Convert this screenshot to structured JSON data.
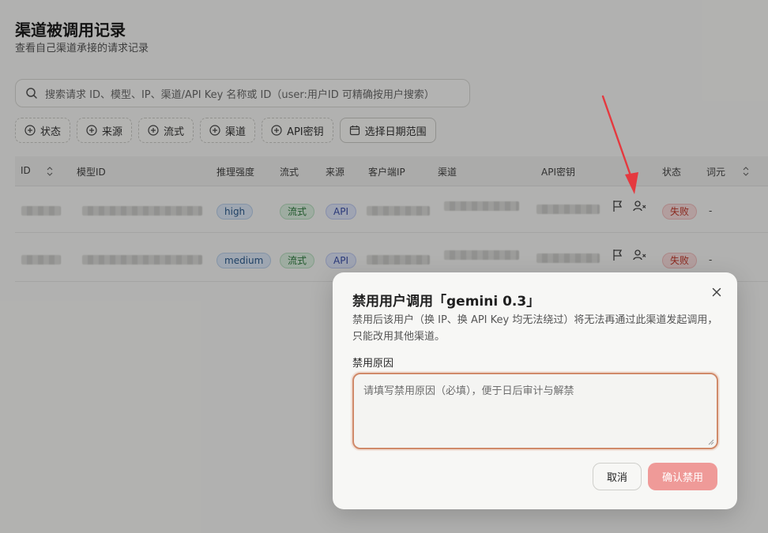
{
  "page": {
    "title": "渠道被调用记录",
    "subtitle": "查看自己渠道承接的请求记录"
  },
  "search": {
    "placeholder": "搜索请求 ID、模型、IP、渠道/API Key 名称或 ID（user:用户ID 可精确按用户搜索）"
  },
  "filters": [
    {
      "label": "状态",
      "icon": "plus-circle-icon"
    },
    {
      "label": "来源",
      "icon": "plus-circle-icon"
    },
    {
      "label": "流式",
      "icon": "plus-circle-icon"
    },
    {
      "label": "渠道",
      "icon": "plus-circle-icon"
    },
    {
      "label": "API密钥",
      "icon": "plus-circle-icon"
    },
    {
      "label": "选择日期范围",
      "icon": "calendar-icon"
    }
  ],
  "table": {
    "columns": [
      "ID",
      "模型ID",
      "推理强度",
      "流式",
      "来源",
      "客户端IP",
      "渠道",
      "API密钥",
      "状态",
      "词元"
    ],
    "rows": [
      {
        "effort": "high",
        "stream": "流式",
        "source": "API",
        "status": "失败",
        "tokens": "-"
      },
      {
        "effort": "medium",
        "stream": "流式",
        "source": "API",
        "status": "失败",
        "tokens": "-"
      }
    ]
  },
  "modal": {
    "title": "禁用用户调用「gemini 0.3」",
    "description": "禁用后该用户（换 IP、换 API Key 均无法绕过）将无法再通过此渠道发起调用，只能改用其他渠道。",
    "reason_label": "禁用原因",
    "reason_placeholder": "请填写禁用原因（必填），便于日后审计与解禁",
    "cancel_label": "取消",
    "confirm_label": "确认禁用"
  },
  "colors": {
    "accent_danger": "#ef9a98",
    "focus_border": "#d08a6a",
    "annotation_arrow": "#e5393f"
  }
}
